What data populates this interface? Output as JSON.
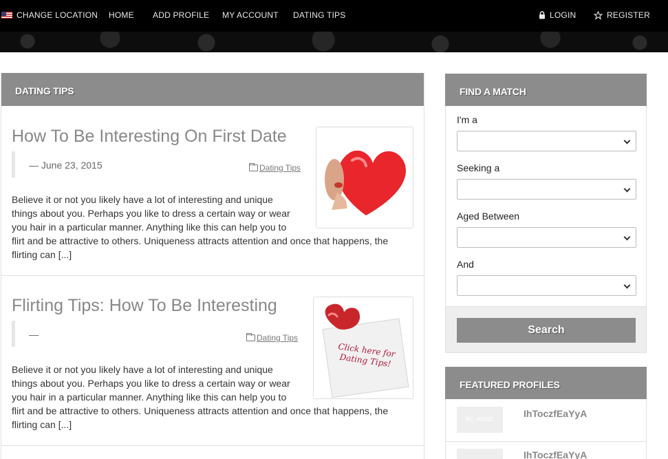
{
  "nav": {
    "change_location": "CHANGE LOCATION",
    "home": "HOME",
    "add_profile": "ADD PROFILE",
    "my_account": "MY ACCOUNT",
    "dating_tips": "DATING TIPS",
    "login": "LOGIN",
    "register": "REGISTER"
  },
  "main": {
    "heading": "DATING TIPS",
    "posts": [
      {
        "title": "How To Be Interesting On First Date",
        "date": "— June 23, 2015",
        "category": "Dating Tips",
        "excerpt_lines": [
          "Believe it or not you likely have a lot of interesting and unique",
          "things about you. Perhaps you like to dress a certain way or wear",
          "you hair in a particular manner. Anything like this can help you to",
          "flirt and be attractive to others. Uniqueness attracts attention and once that happens, the",
          "flirting can [...]"
        ]
      },
      {
        "title": "Flirting Tips: How To Be Interesting",
        "date": "—",
        "category": "Dating Tips",
        "image_text": "Click here for Dating Tips!",
        "excerpt_lines": [
          "Believe it or not you likely have a lot of interesting and unique",
          "things about you. Perhaps you like to dress a certain way or wear",
          "you hair in a particular manner. Anything like this can help you to",
          "flirt and be attractive to others. Uniqueness attracts attention and once that happens, the",
          "flirting can [...]"
        ]
      }
    ]
  },
  "sidebar": {
    "find_match": {
      "heading": "FIND A MATCH",
      "im_a": "I'm a",
      "seeking": "Seeking a",
      "aged_between": "Aged Between",
      "and": "And",
      "search": "Search"
    },
    "featured": {
      "heading": "FEATURED PROFILES",
      "no_image": "NO IMAGE",
      "profiles": [
        "IhToczfEaYyA",
        "IhToczfEaYyA"
      ]
    }
  },
  "colors": {
    "panel_header": "#8c8c8c",
    "topbar": "#000000",
    "title_gray": "#888888"
  }
}
